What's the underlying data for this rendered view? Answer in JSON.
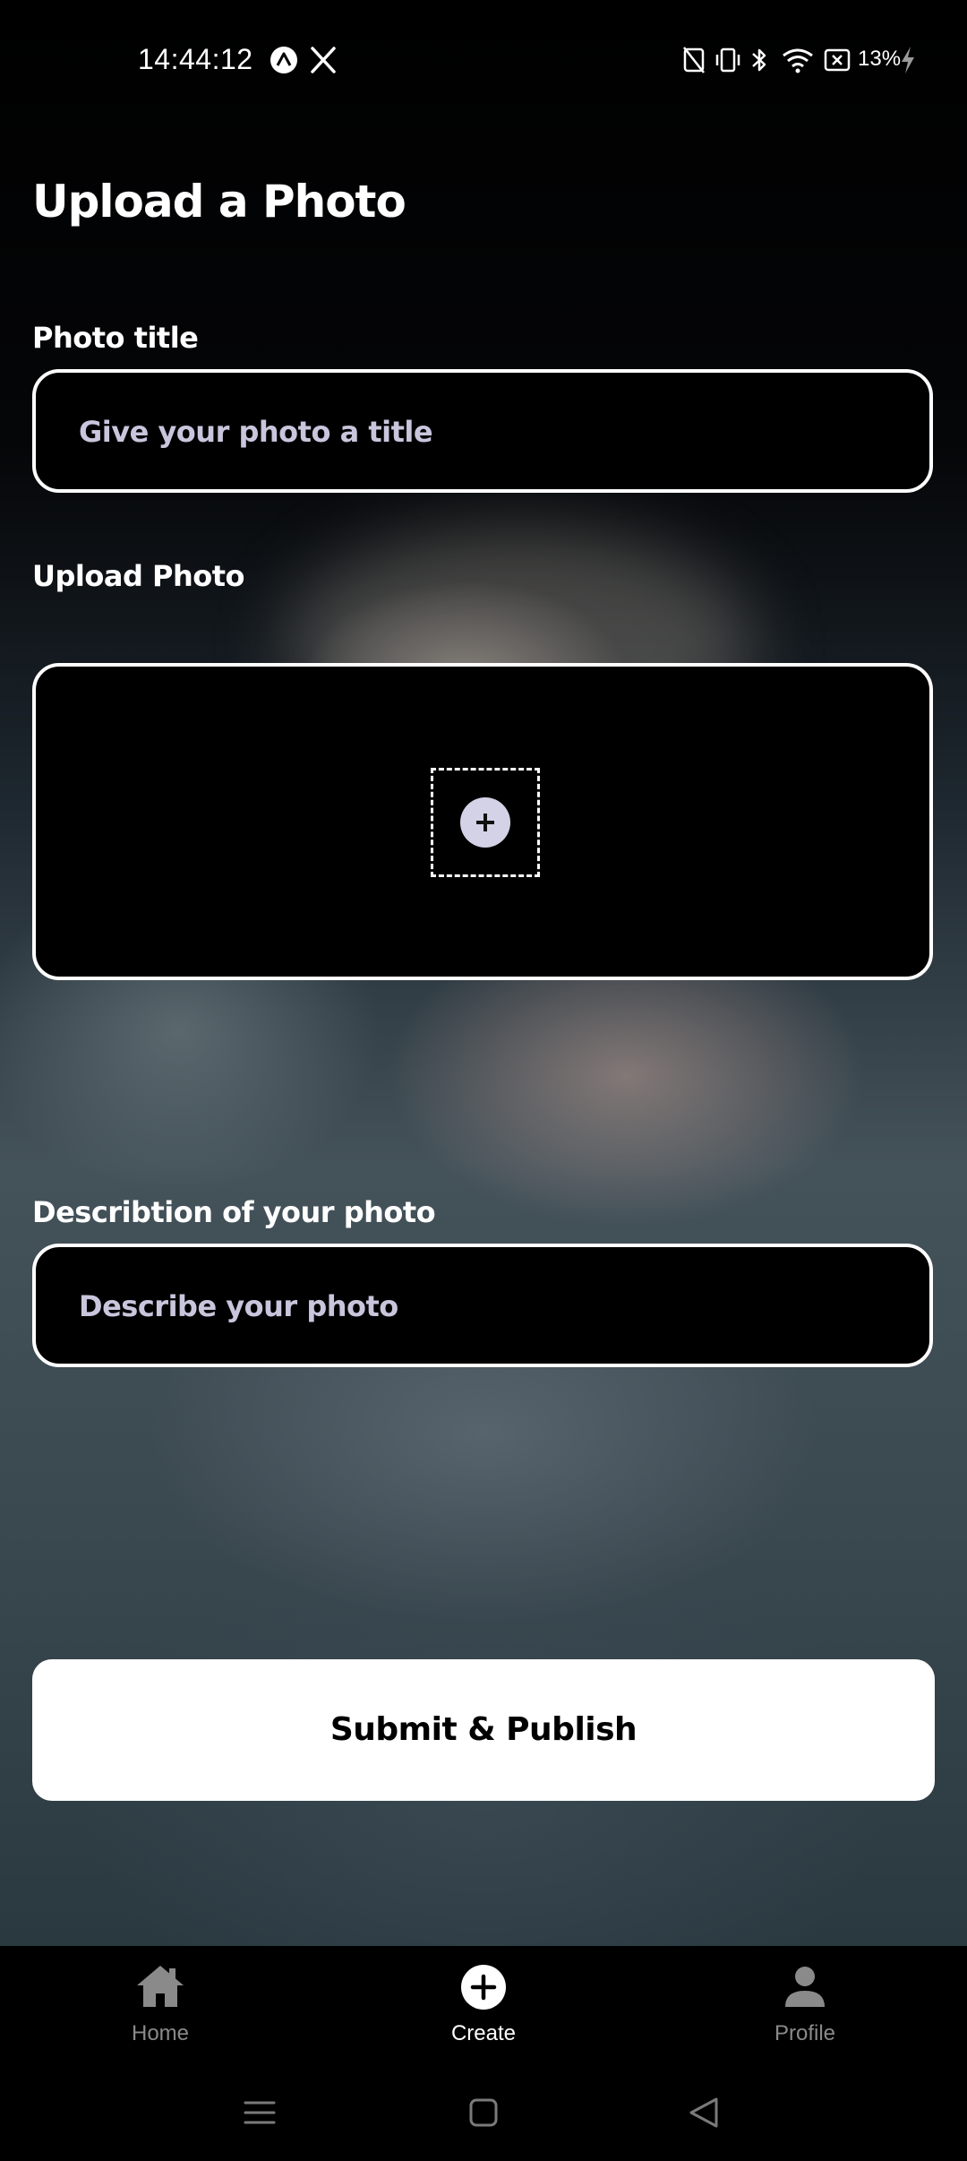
{
  "status_bar": {
    "time": "14:44:12",
    "battery": "13%",
    "icons": [
      "assistant-icon",
      "x-icon",
      "nfc-off-icon",
      "vibrate-icon",
      "bluetooth-icon",
      "wifi-icon",
      "battery-saver-icon",
      "charging-icon"
    ]
  },
  "page": {
    "title": "Upload a Photo"
  },
  "form": {
    "title_label": "Photo title",
    "title_placeholder": "Give your photo a title",
    "title_value": "",
    "upload_label": "Upload Photo",
    "description_label": "Describtion of your photo",
    "description_placeholder": "Describe your photo",
    "description_value": "",
    "submit_label": "Submit & Publish"
  },
  "tabs": [
    {
      "label": "Home",
      "icon": "home-icon",
      "active": false
    },
    {
      "label": "Create",
      "icon": "add-circle-icon",
      "active": true
    },
    {
      "label": "Profile",
      "icon": "person-icon",
      "active": false
    }
  ],
  "colors": {
    "accent": "#ffffff",
    "placeholder": "#c9c5dc",
    "tab_inactive": "#8a8a8a",
    "upload_plus": "#d4d2e6"
  }
}
